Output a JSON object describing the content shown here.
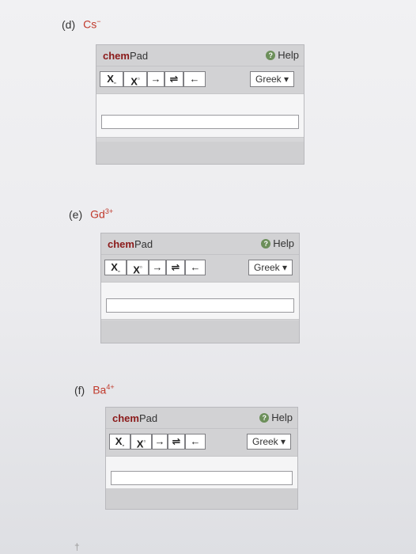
{
  "questions": [
    {
      "letter": "(d)",
      "species": "Cs",
      "charge": "−"
    },
    {
      "letter": "(e)",
      "species": "Gd",
      "charge": "3+"
    },
    {
      "letter": "(f)",
      "species": "Ba",
      "charge": "4+"
    }
  ],
  "chempad": {
    "title_bold": "chem",
    "title_rest": "Pad",
    "help_label": "Help",
    "greek_label": "Greek ▾",
    "btn_subscript": "X",
    "btn_superscript": "X",
    "btn_arrow": "→",
    "btn_equilibrium": "⇌",
    "btn_left_arrow": "←"
  },
  "colors": {
    "species": "#c0392b",
    "chem": "#8b1a1a"
  }
}
